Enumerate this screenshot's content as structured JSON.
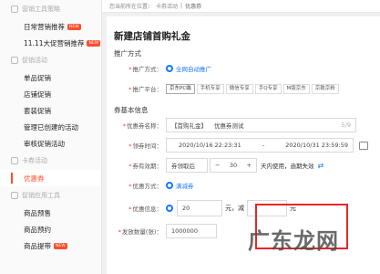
{
  "sidebar": {
    "sections": [
      {
        "label": "营销工具策略",
        "items": [
          {
            "label": "日常营销推荐",
            "badge": "NEW"
          },
          {
            "label": "11.11大促营销推荐",
            "badge": "NEW"
          }
        ]
      },
      {
        "label": "促销活动",
        "items": [
          {
            "label": "单品促销"
          },
          {
            "label": "店铺促销"
          },
          {
            "label": "套装促销"
          },
          {
            "label": "管理已创建的活动"
          },
          {
            "label": "审核促销活动"
          }
        ]
      },
      {
        "label": "卡券活动",
        "items": [
          {
            "label": "优惠券",
            "active": true
          }
        ]
      },
      {
        "label": "促销应用工具",
        "items": [
          {
            "label": "商品预售"
          },
          {
            "label": "商品预约"
          },
          {
            "label": "商品提带",
            "badge": "NEW"
          }
        ]
      }
    ]
  },
  "breadcrumb": {
    "prefix": "您当前所在位置：",
    "parent": "卡券活动",
    "current": "优惠券"
  },
  "page_title": "新建店铺首购礼金",
  "promo": {
    "section_title": "推广方式",
    "method_label": "推广方式：",
    "method_value": "全网自动推广",
    "platform_label": "推广平台：",
    "platforms": [
      "京东PC端",
      "手机专享",
      "微信专享",
      "手Q专享",
      "M版京东",
      "京致京粉"
    ]
  },
  "basic": {
    "section_title": "券基本信息",
    "name_label": "优惠券名称：",
    "name_prefix": "【首购礼金】",
    "name_value": "优惠券测试",
    "name_count": "5/9",
    "time_label": "领券时间：",
    "start_time": "2020/10/16 22:23:31",
    "end_time": "2020/10/31 23:59:59",
    "validity_label": "券有效期：",
    "validity_mode": "券领取后",
    "validity_days": "30",
    "validity_suffix": "天内使用，逾期失效",
    "type_label": "优惠方式：",
    "type_value": "满减券",
    "amount_label": "优惠信息：",
    "threshold": "20",
    "unit": "元，减",
    "unit2": "元",
    "qty_label": "发放数量(张)：",
    "qty_value": "1000000"
  },
  "watermark": "广东龙网"
}
